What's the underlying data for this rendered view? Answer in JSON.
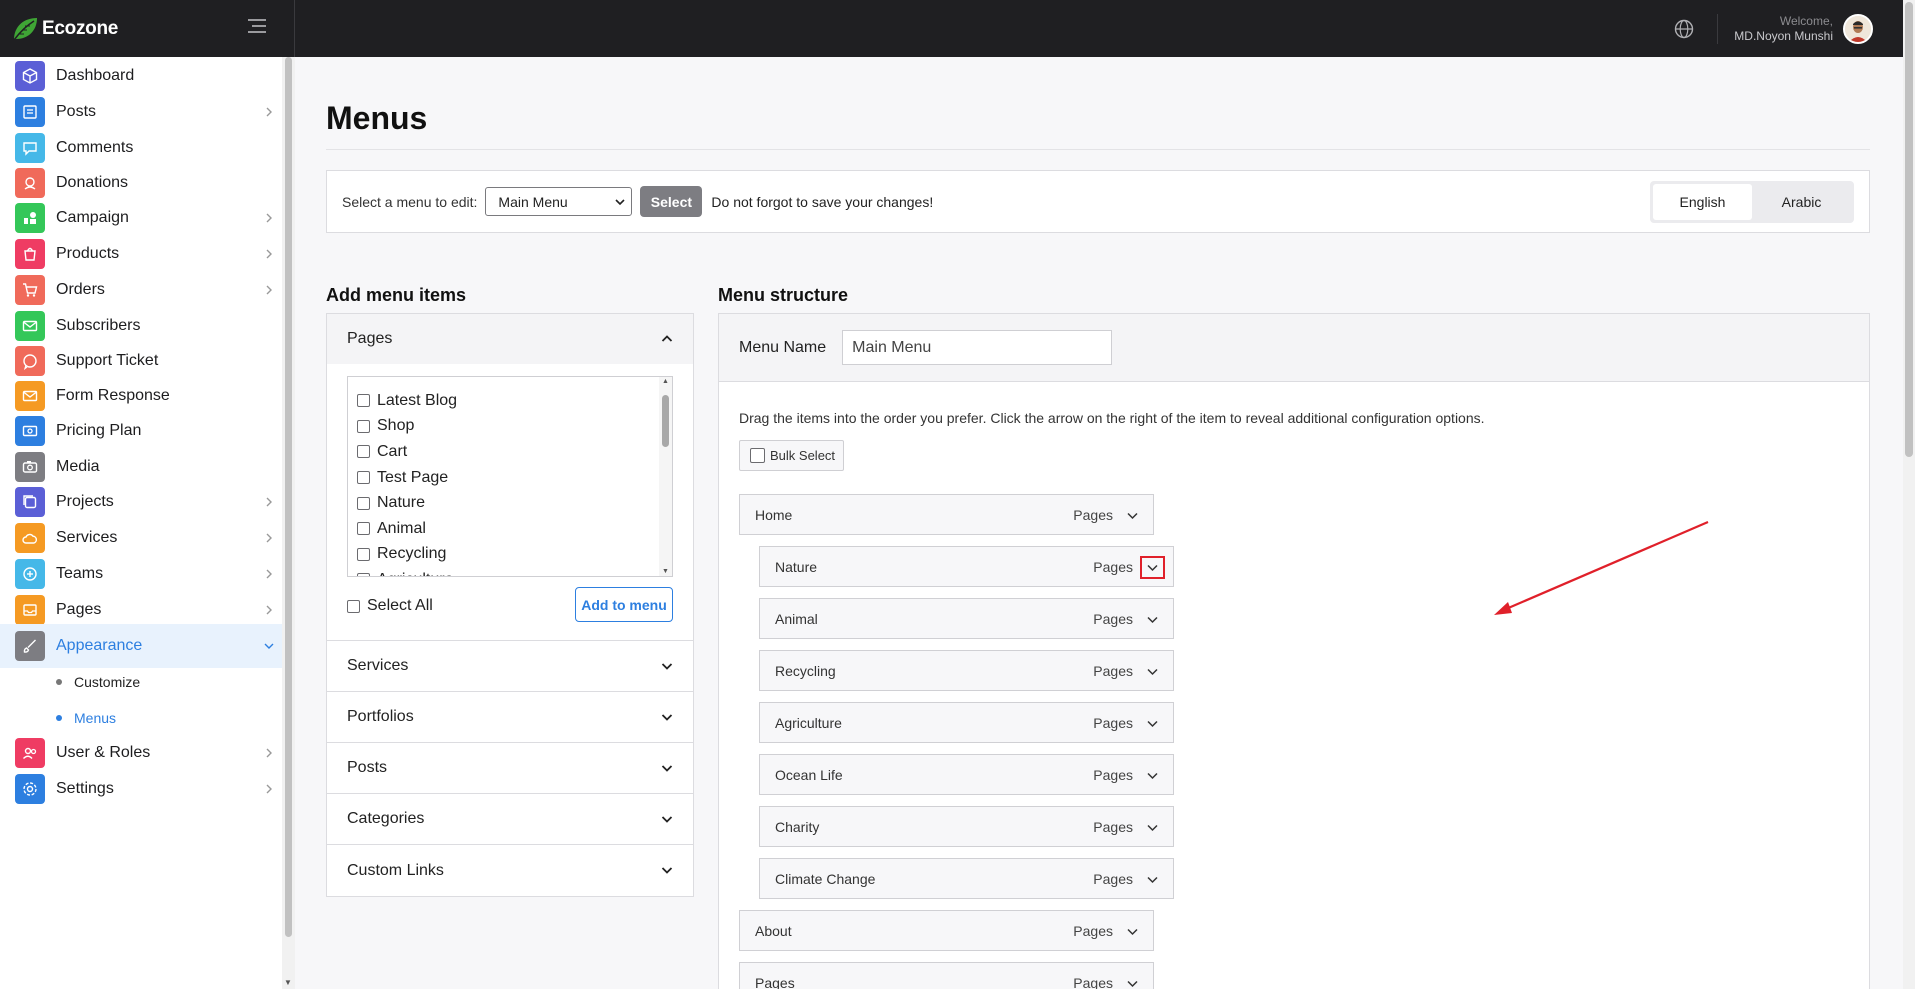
{
  "brand": {
    "name": "Ecozone"
  },
  "topbar": {
    "welcome": "Welcome,",
    "user_name": "MD.Noyon Munshi"
  },
  "sidebar": {
    "items": [
      {
        "label": "Dashboard",
        "color": "#5b5fd6",
        "has_arrow": false
      },
      {
        "label": "Posts",
        "color": "#2d7fe0",
        "has_arrow": true
      },
      {
        "label": "Comments",
        "color": "#45b8e8",
        "has_arrow": false
      },
      {
        "label": "Donations",
        "color": "#f06a5a",
        "has_arrow": false
      },
      {
        "label": "Campaign",
        "color": "#34c759",
        "has_arrow": true
      },
      {
        "label": "Products",
        "color": "#ef3c63",
        "has_arrow": true
      },
      {
        "label": "Orders",
        "color": "#f06a5a",
        "has_arrow": true
      },
      {
        "label": "Subscribers",
        "color": "#34c759",
        "has_arrow": false
      },
      {
        "label": "Support Ticket",
        "color": "#f06a5a",
        "has_arrow": false
      },
      {
        "label": "Form Response",
        "color": "#f59a23",
        "has_arrow": false
      },
      {
        "label": "Pricing Plan",
        "color": "#2d7fe0",
        "has_arrow": false
      },
      {
        "label": "Media",
        "color": "#7d7d82",
        "has_arrow": false
      },
      {
        "label": "Projects",
        "color": "#5b5fd6",
        "has_arrow": true
      },
      {
        "label": "Services",
        "color": "#f59a23",
        "has_arrow": true
      },
      {
        "label": "Teams",
        "color": "#45b8e8",
        "has_arrow": true
      },
      {
        "label": "Pages",
        "color": "#f59a23",
        "has_arrow": true
      },
      {
        "label": "Appearance",
        "color": "#7d7d82",
        "has_arrow": true,
        "active": true
      },
      {
        "label": "User & Roles",
        "color": "#ef3c63",
        "has_arrow": true
      },
      {
        "label": "Settings",
        "color": "#2d7fe0",
        "has_arrow": true
      }
    ],
    "appearance_sub": [
      {
        "label": "Customize"
      },
      {
        "label": "Menus",
        "active": true
      }
    ]
  },
  "page": {
    "title": "Menus"
  },
  "select_bar": {
    "label": "Select a menu to edit:",
    "selected_menu": "Main Menu",
    "select_button": "Select",
    "note": "Do not forgot to save your changes!",
    "languages": [
      "English",
      "Arabic"
    ],
    "active_language": "English"
  },
  "add_items": {
    "title": "Add menu items",
    "sections": [
      "Pages",
      "Services",
      "Portfolios",
      "Posts",
      "Categories",
      "Custom Links"
    ],
    "pages": [
      "Latest Blog",
      "Shop",
      "Cart",
      "Test Page",
      "Nature",
      "Animal",
      "Recycling",
      "Agriculture"
    ],
    "select_all": "Select All",
    "add_button": "Add to menu"
  },
  "structure": {
    "title": "Menu structure",
    "menu_name_label": "Menu Name",
    "menu_name_value": "Main Menu",
    "hint": "Drag the items into the order you prefer. Click the arrow on the right of the item to reveal additional configuration options.",
    "bulk_select": "Bulk Select",
    "items": [
      {
        "label": "Home",
        "type": "Pages",
        "level": 0
      },
      {
        "label": "Nature",
        "type": "Pages",
        "level": 1,
        "highlighted": true
      },
      {
        "label": "Animal",
        "type": "Pages",
        "level": 1
      },
      {
        "label": "Recycling",
        "type": "Pages",
        "level": 1
      },
      {
        "label": "Agriculture",
        "type": "Pages",
        "level": 1
      },
      {
        "label": "Ocean Life",
        "type": "Pages",
        "level": 1
      },
      {
        "label": "Charity",
        "type": "Pages",
        "level": 1
      },
      {
        "label": "Climate Change",
        "type": "Pages",
        "level": 1
      },
      {
        "label": "About",
        "type": "Pages",
        "level": 0
      },
      {
        "label": "Pages",
        "type": "Pages",
        "level": 0
      }
    ]
  },
  "colors": {
    "accent": "#2d7fe0",
    "topbar": "#1f1f22",
    "highlight": "#e0202a"
  }
}
